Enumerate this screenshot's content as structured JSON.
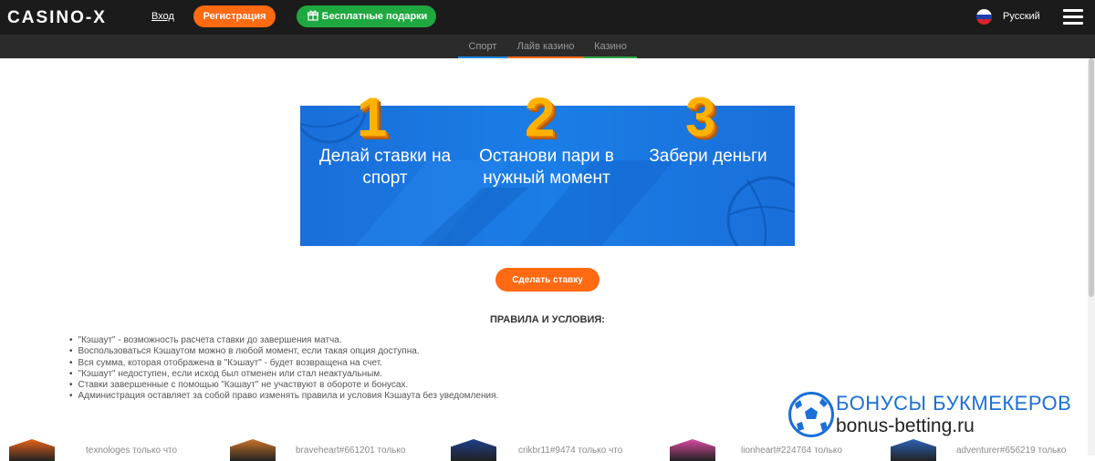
{
  "header": {
    "logo": "CASINO-X",
    "login": "Вход",
    "register": "Регистрация",
    "gifts": "Бесплатные подарки",
    "language": "Русский",
    "icons": {
      "gift": "gift-icon",
      "flag": "russia-flag-icon",
      "menu": "hamburger-menu-icon"
    }
  },
  "tabs": [
    {
      "label": "Спорт",
      "color": "#1e88e5"
    },
    {
      "label": "Лайв казино",
      "color": "#ff6a13"
    },
    {
      "label": "Казино",
      "color": "#2ea84a"
    }
  ],
  "banner": {
    "steps": [
      {
        "number": "1",
        "text": "Делай ставки на спорт"
      },
      {
        "number": "2",
        "text": "Останови пари в нужный момент"
      },
      {
        "number": "3",
        "text": "Забери деньги"
      }
    ]
  },
  "cta": "Сделать ставку",
  "rules": {
    "title": "ПРАВИЛА И УСЛОВИЯ:",
    "items": [
      "\"Кэшаут\" - возможность расчета ставки до завершения матча.",
      "Воспользоваться Кэшаутом можно в любой момент, если такая опция доступна.",
      "Вся сумма, которая отображена в \"Кэшаут\" - будет возвращена на счет.",
      "\"Кэшаут\" недоступен, если исход был отменен или стал неактуальным.",
      "Ставки завершенные с помощью \"Кэшаут\" не участвуют в обороте и бонусах.",
      "Администрация оставляет за собой право изменять правила и условия Кэшаута без уведомления."
    ]
  },
  "winners": [
    {
      "text": "texnologes только что",
      "color": "#e8631a"
    },
    {
      "text": "braveheart#661201 только",
      "color": "#c9742a"
    },
    {
      "text": "crikbr11#9474 только что",
      "color": "#1f3f8a"
    },
    {
      "text": "lionheart#224764 только",
      "color": "#d94aa0"
    },
    {
      "text": "adventurer#656219 только",
      "color": "#2a63b8"
    }
  ],
  "watermark": {
    "title": "БОНУСЫ БУКМЕКЕРОВ",
    "url": "bonus-betting.ru"
  },
  "colors": {
    "orange": "#ff6a13",
    "green": "#1fa83f",
    "banner_blue": "#1a6fd9",
    "digit_gold": "#ffb300"
  }
}
